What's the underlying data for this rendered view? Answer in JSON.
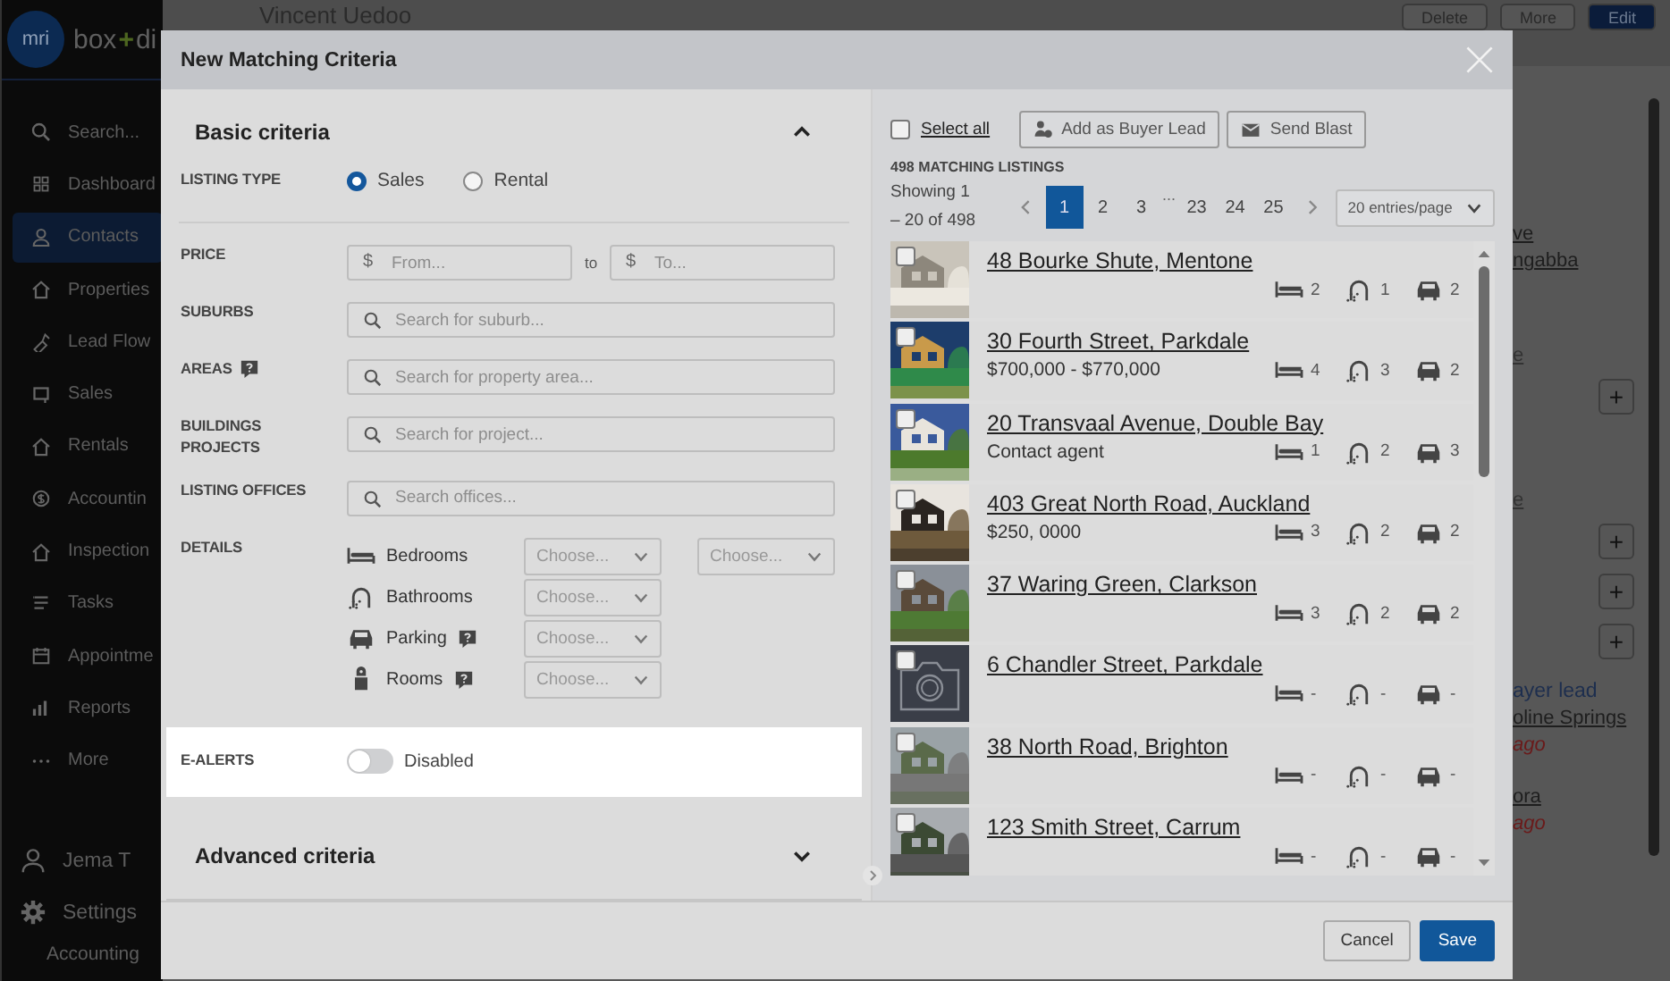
{
  "sidebar": {
    "logo_mark": "mri",
    "logo_parts": [
      "box",
      "+",
      "di"
    ],
    "items": [
      {
        "label": "Search...",
        "selected": false
      },
      {
        "label": "Dashboard",
        "selected": false
      },
      {
        "label": "Contacts",
        "selected": true
      },
      {
        "label": "Properties",
        "selected": false
      },
      {
        "label": "Lead Flow",
        "selected": false
      },
      {
        "label": "Sales",
        "selected": false
      },
      {
        "label": "Rentals",
        "selected": false
      },
      {
        "label": "Accountin",
        "selected": false
      },
      {
        "label": "Inspection",
        "selected": false
      },
      {
        "label": "Tasks",
        "selected": false
      },
      {
        "label": "Appointme",
        "selected": false
      },
      {
        "label": "Reports",
        "selected": false
      },
      {
        "label": "More",
        "selected": false
      }
    ],
    "user": "Jema T",
    "settings": "Settings",
    "footer": "Accounting"
  },
  "page": {
    "title": "Vincent Uedoo",
    "actions": [
      "Delete",
      "More",
      "Edit"
    ],
    "fragments": [
      {
        "kind": "link",
        "text": "ve"
      },
      {
        "kind": "link",
        "text": "ngabba"
      },
      {
        "kind": "faint",
        "text": "e"
      },
      {
        "kind": "plus",
        "text": "+"
      },
      {
        "kind": "faint",
        "text": "e"
      },
      {
        "kind": "plus",
        "text": "+"
      },
      {
        "kind": "plus",
        "text": "+"
      },
      {
        "kind": "plus",
        "text": "+"
      },
      {
        "kind": "accent",
        "text": "ayer lead"
      },
      {
        "kind": "link",
        "text": "oline Springs"
      },
      {
        "kind": "time",
        "text": "ago"
      },
      {
        "kind": "link",
        "text": "ora"
      },
      {
        "kind": "time",
        "text": "ago"
      }
    ]
  },
  "modal": {
    "title": "New Matching Criteria",
    "basic": {
      "title": "Basic criteria",
      "expanded": true
    },
    "listing_type": {
      "label": "LISTING TYPE",
      "options": [
        {
          "label": "Sales",
          "selected": true
        },
        {
          "label": "Rental",
          "selected": false
        }
      ]
    },
    "price": {
      "label": "PRICE",
      "from": {
        "prefix": "$",
        "placeholder": "From..."
      },
      "to_text": "to",
      "to": {
        "prefix": "$",
        "placeholder": "To..."
      }
    },
    "searches": [
      {
        "label": "SUBURBS",
        "help": false,
        "placeholder": "Search for suburb..."
      },
      {
        "label": "AREAS",
        "help": true,
        "placeholder": "Search for property area..."
      },
      {
        "label": "BUILDINGS PROJECTS",
        "help": false,
        "placeholder": "Search for project..."
      },
      {
        "label": "LISTING OFFICES",
        "help": false,
        "placeholder": "Search offices..."
      }
    ],
    "details": {
      "label": "DETAILS",
      "rows": [
        {
          "label": "Bedrooms",
          "help": false,
          "selects": [
            "Choose...",
            "Choose..."
          ]
        },
        {
          "label": "Bathrooms",
          "help": false,
          "selects": [
            "Choose..."
          ]
        },
        {
          "label": "Parking",
          "help": true,
          "selects": [
            "Choose..."
          ]
        },
        {
          "label": "Rooms",
          "help": true,
          "selects": [
            "Choose..."
          ]
        }
      ]
    },
    "e_alerts": {
      "label": "E-ALERTS",
      "on": false,
      "text": "Disabled"
    },
    "advanced": {
      "title": "Advanced criteria",
      "expanded": false
    },
    "select_all": {
      "label": "Select all",
      "checked": false
    },
    "actions": [
      "Add as Buyer Lead",
      "Send Blast"
    ],
    "count": "498 MATCHING LISTINGS",
    "showing": "Showing 1 – 20 of 498",
    "pages": [
      {
        "label": "1",
        "selected": true
      },
      {
        "label": "2",
        "selected": false
      },
      {
        "label": "3",
        "selected": false
      },
      {
        "label": "...",
        "selected": false
      },
      {
        "label": "23",
        "selected": false
      },
      {
        "label": "24",
        "selected": false
      },
      {
        "label": "25",
        "selected": false
      }
    ],
    "per_page": "20 entries/page",
    "listings": [
      {
        "address": "48 Bourke Shute, Mentone",
        "kind": "picture",
        "checked": false,
        "beds": "2",
        "baths": "1",
        "cars": "2"
      },
      {
        "address": "30 Fourth Street, Parkdale",
        "price": "$700,000 - $770,000",
        "kind": "picture",
        "checked": false,
        "beds": "4",
        "baths": "3",
        "cars": "2"
      },
      {
        "address": "20 Transvaal Avenue, Double Bay",
        "price": "Contact agent",
        "kind": "picture",
        "checked": false,
        "beds": "1",
        "baths": "2",
        "cars": "3"
      },
      {
        "address": "403 Great North Road, Auckland",
        "price": "$250, 0000",
        "kind": "picture",
        "checked": false,
        "beds": "3",
        "baths": "2",
        "cars": "2"
      },
      {
        "address": "37 Waring Green, Clarkson",
        "kind": "picture",
        "checked": false,
        "beds": "3",
        "baths": "2",
        "cars": "2"
      },
      {
        "address": "6 Chandler Street, Parkdale",
        "kind": "no-photo",
        "checked": false,
        "beds": "-",
        "baths": "-",
        "cars": "-"
      },
      {
        "address": "38 North Road, Brighton",
        "kind": "picture",
        "checked": false,
        "beds": "-",
        "baths": "-",
        "cars": "-"
      },
      {
        "address": "123 Smith Street, Carrum",
        "kind": "picture",
        "checked": false,
        "beds": "-",
        "baths": "-",
        "cars": "-"
      }
    ],
    "buttons": [
      "Cancel",
      "Save"
    ]
  }
}
